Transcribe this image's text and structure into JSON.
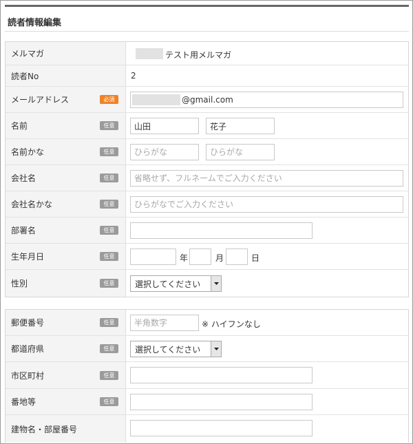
{
  "page_title": "読者情報編集",
  "badges": {
    "required": "必須",
    "optional": "任意"
  },
  "fields": {
    "magazine": {
      "label": "メルマガ",
      "value": "テスト用メルマガ"
    },
    "reader_no": {
      "label": "読者No",
      "value": "2"
    },
    "email": {
      "label": "メールアドレス",
      "value": "@gmail.com"
    },
    "name": {
      "label": "名前",
      "last_value": "山田",
      "first_value": "花子"
    },
    "name_kana": {
      "label": "名前かな",
      "last_placeholder": "ひらがな",
      "first_placeholder": "ひらがな"
    },
    "company": {
      "label": "会社名",
      "placeholder": "省略せず、フルネームでご入力ください"
    },
    "company_kana": {
      "label": "会社名かな",
      "placeholder": "ひらがなでご入力ください"
    },
    "department": {
      "label": "部署名",
      "value": ""
    },
    "birthdate": {
      "label": "生年月日",
      "year_unit": "年",
      "month_unit": "月",
      "day_unit": "日"
    },
    "gender": {
      "label": "性別",
      "selected": "選択してください"
    },
    "postal_code": {
      "label": "郵便番号",
      "placeholder": "半角数字",
      "note": "※ ハイフンなし"
    },
    "prefecture": {
      "label": "都道府県",
      "selected": "選択してください"
    },
    "city": {
      "label": "市区町村",
      "value": ""
    },
    "address": {
      "label": "番地等",
      "value": ""
    },
    "building": {
      "label": "建物名・部屋番号",
      "value": ""
    }
  },
  "colors": {
    "required_badge": "#f08326",
    "optional_badge": "#9b9b9b",
    "label_bg": "#f4f4f4"
  }
}
